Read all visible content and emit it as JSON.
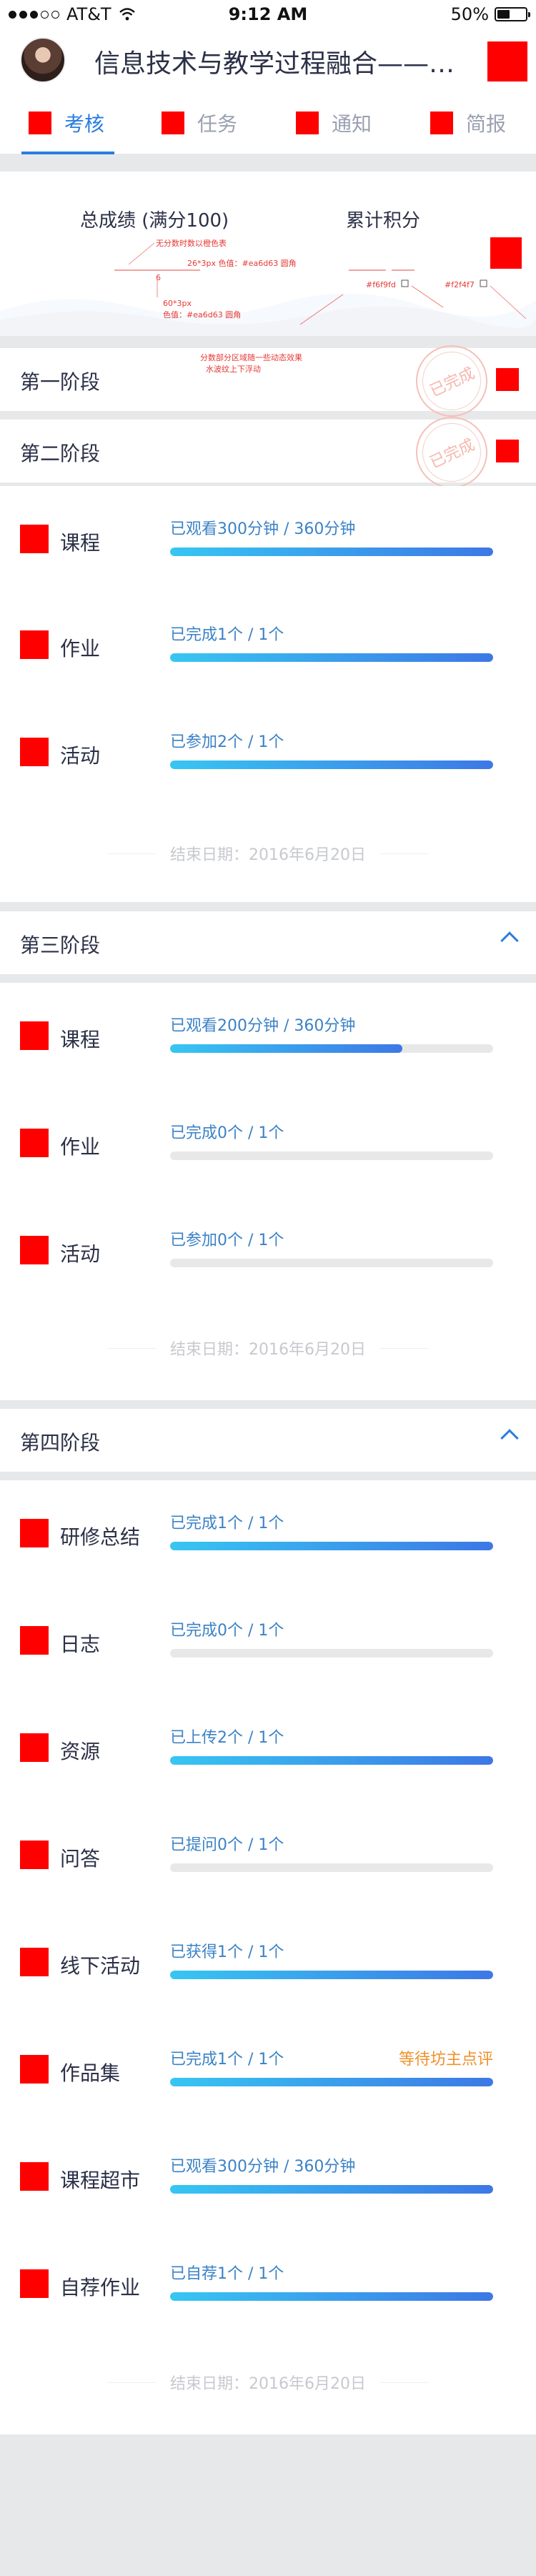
{
  "status_bar": {
    "carrier": "AT&T",
    "time": "9:12 AM",
    "battery": "50%",
    "battery_level": 0.5
  },
  "header": {
    "title": "信息技术与教学过程融合——教..."
  },
  "tabs": [
    {
      "label": "考核",
      "active": true
    },
    {
      "label": "任务",
      "active": false
    },
    {
      "label": "通知",
      "active": false
    },
    {
      "label": "简报",
      "active": false
    }
  ],
  "score": {
    "total_label": "总成绩 (满分100)",
    "points_label": "累计积分",
    "notes": {
      "n1": "无分数时数以橙色表",
      "n2": "26*3px  色值：#ea6d63  圆角",
      "n3": "6",
      "n4": "60*3px",
      "n5": "色值：#ea6d63  圆角",
      "n6": "#f6f9fd",
      "n7": "#f2f4f7",
      "n8": "分数部分区域随一些动态效果",
      "n9": "水波纹上下浮动"
    }
  },
  "stages": [
    {
      "title": "第一阶段",
      "stamp": "已完成"
    },
    {
      "title": "第二阶段",
      "stamp": "已完成",
      "items": [
        {
          "name": "课程",
          "text": "已观看300分钟 / 360分钟",
          "progress": 1.0
        },
        {
          "name": "作业",
          "text": "已完成1个 / 1个",
          "progress": 1.0
        },
        {
          "name": "活动",
          "text": "已参加2个 / 1个",
          "progress": 1.0
        }
      ],
      "end_date": "结束日期：2016年6月20日"
    },
    {
      "title": "第三阶段",
      "items": [
        {
          "name": "课程",
          "text": "已观看200分钟 / 360分钟",
          "progress": 0.72
        },
        {
          "name": "作业",
          "text": "已完成0个 / 1个",
          "progress": 0
        },
        {
          "name": "活动",
          "text": "已参加0个 / 1个",
          "progress": 0
        }
      ],
      "end_date": "结束日期：2016年6月20日"
    },
    {
      "title": "第四阶段",
      "items": [
        {
          "name": "研修总结",
          "text": "已完成1个 / 1个",
          "progress": 1.0
        },
        {
          "name": "日志",
          "text": "已完成0个 / 1个",
          "progress": 0
        },
        {
          "name": "资源",
          "text": "已上传2个 / 1个",
          "progress": 1.0
        },
        {
          "name": "问答",
          "text": "已提问0个 / 1个",
          "progress": 0
        },
        {
          "name": "线下活动",
          "text": "已获得1个 / 1个",
          "progress": 1.0
        },
        {
          "name": "作品集",
          "text": "已完成1个 / 1个",
          "progress": 1.0,
          "note": "等待坊主点评"
        },
        {
          "name": "课程超市",
          "text": "已观看300分钟 / 360分钟",
          "progress": 1.0
        },
        {
          "name": "自荐作业",
          "text": "已自荐1个 / 1个",
          "progress": 1.0
        }
      ],
      "end_date": "结束日期：2016年6月20日"
    }
  ]
}
